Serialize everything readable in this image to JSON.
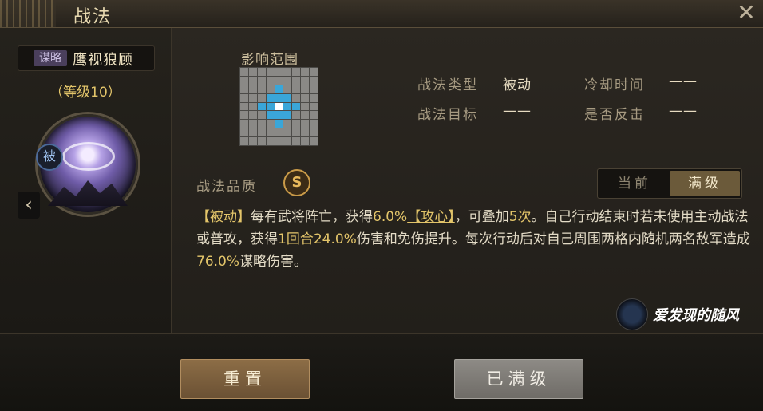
{
  "window": {
    "title": "战法",
    "close_icon": "close-icon"
  },
  "skill": {
    "type_tag": "谋略",
    "name": "鹰视狼顾",
    "level": "（等级10）",
    "passive_badge": "被",
    "prev_arrow": "‹"
  },
  "range": {
    "label": "影响范围",
    "grid_size": 9,
    "hit_cells": [
      [
        3,
        4
      ],
      [
        4,
        3
      ],
      [
        4,
        5
      ],
      [
        5,
        4
      ],
      [
        2,
        4
      ],
      [
        4,
        2
      ],
      [
        4,
        6
      ],
      [
        6,
        4
      ],
      [
        3,
        3
      ],
      [
        3,
        5
      ],
      [
        5,
        3
      ],
      [
        5,
        5
      ]
    ],
    "self_cell": [
      4,
      4
    ]
  },
  "info": {
    "type_label": "战法类型",
    "type_value": "被动",
    "cooldown_label": "冷却时间",
    "cooldown_value": "——",
    "target_label": "战法目标",
    "target_value": "——",
    "counter_label": "是否反击",
    "counter_value": "——"
  },
  "quality": {
    "label": "战法品质",
    "grade": "S"
  },
  "toggle": {
    "current": "当前",
    "max": "满级",
    "selected": "max"
  },
  "description": {
    "tag": "【被动】",
    "p1": "每有武将阵亡，获得",
    "v1": "6.0%",
    "kw": "【攻心】",
    "p2": "，可叠加",
    "v2": "5次",
    "p3": "。自己行动结束时若未使用主动战法或普攻，获得",
    "v3": "1回合24.0%",
    "p4": "伤害和免伤提升。每次行动后对自己周围两格内随机两名敌军造成",
    "v4": "76.0%",
    "p5": "谋略伤害。"
  },
  "watermark": {
    "text": "爱发现的随风"
  },
  "footer": {
    "reset_label": "重置",
    "maxed_label": "已满级"
  },
  "colors": {
    "highlight": "#e3c56a",
    "grid_hit": "#3aa6d8",
    "accent": "#c99a48"
  }
}
